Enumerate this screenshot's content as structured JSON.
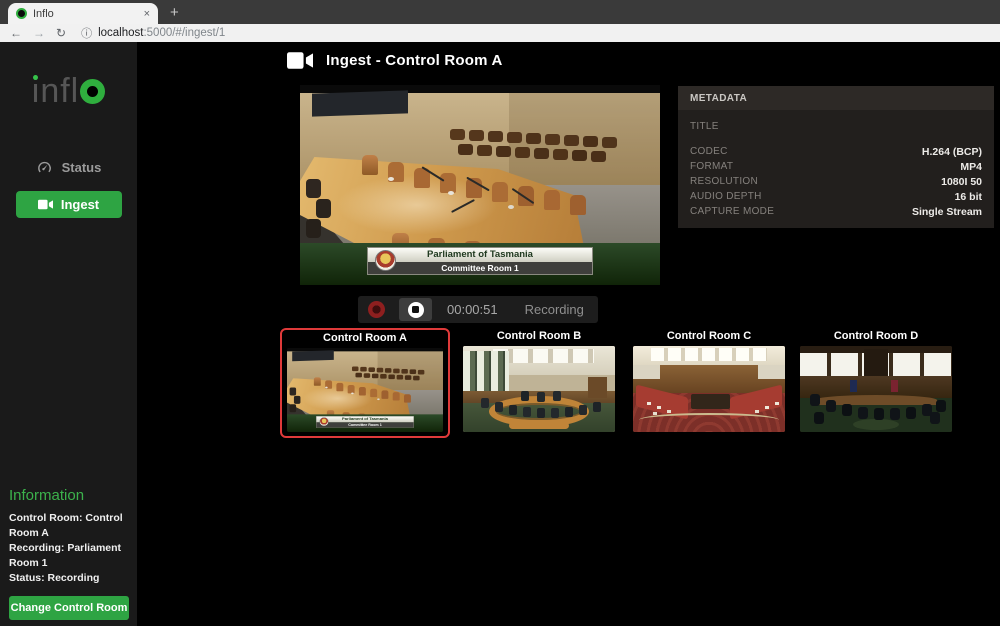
{
  "browser": {
    "tab_title": "Inflo",
    "url_host": "localhost",
    "url_rest": ":5000/#/ingest/1",
    "icons": {
      "close_tab": "×",
      "new_tab": "+",
      "back": "←",
      "forward": "→",
      "refresh": "↻",
      "info": "ⓘ"
    }
  },
  "sidebar": {
    "logo_text": "infl",
    "status_label": "Status",
    "ingest_label": "Ingest",
    "information": {
      "heading": "Information",
      "lines": [
        "Control Room: Control Room A",
        "Recording: Parliament Room 1",
        "Status: Recording"
      ],
      "change_button": "Change Control Room"
    }
  },
  "main": {
    "title": "Ingest - Control Room A",
    "preview": {
      "banner_title": "Parliament of Tasmania",
      "banner_subtitle": "Committee Room 1"
    },
    "metadata": {
      "heading": "METADATA",
      "rows": [
        {
          "label": "TITLE",
          "value": ""
        },
        {
          "label": "CODEC",
          "value": "H.264 (BCP)"
        },
        {
          "label": "FORMAT",
          "value": "MP4"
        },
        {
          "label": "RESOLUTION",
          "value": "1080I 50"
        },
        {
          "label": "AUDIO DEPTH",
          "value": "16 bit"
        },
        {
          "label": "CAPTURE MODE",
          "value": "Single Stream"
        }
      ]
    },
    "controls": {
      "timer": "00:00:51",
      "status": "Recording"
    },
    "thumbnails": [
      {
        "label": "Control Room A",
        "selected": true
      },
      {
        "label": "Control Room B",
        "selected": false
      },
      {
        "label": "Control Room C",
        "selected": false
      },
      {
        "label": "Control Room D",
        "selected": false
      }
    ],
    "colors": {
      "accent_green": "#2ea443",
      "selected_border_red": "#df3a3a",
      "record_red": "#8e1f1f"
    }
  }
}
